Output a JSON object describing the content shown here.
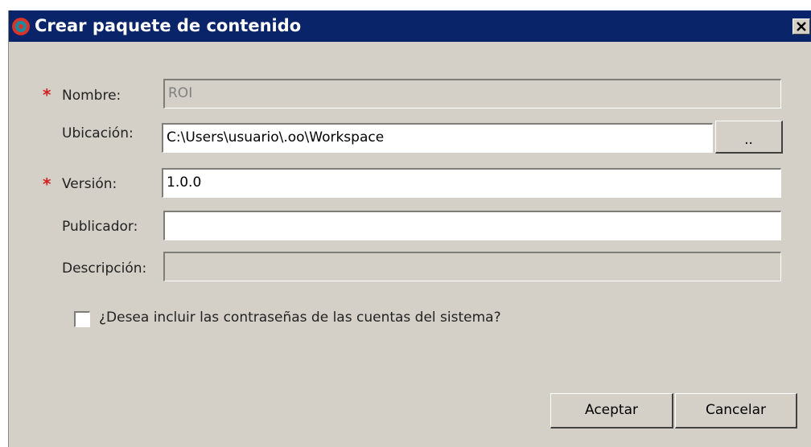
{
  "window": {
    "title": "Crear paquete de contenido",
    "icon": "app-logo-icon",
    "close_icon": "close-icon"
  },
  "form": {
    "nombre": {
      "label": "Nombre:",
      "value": "ROI",
      "required_mark": "*"
    },
    "ubicacion": {
      "label": "Ubicación:",
      "value": "C:\\Users\\usuario\\.oo\\Workspace",
      "browse_label": ".."
    },
    "version": {
      "label": "Versión:",
      "value": "1.0.0",
      "required_mark": "*"
    },
    "publicador": {
      "label": "Publicador:",
      "value": ""
    },
    "descripcion": {
      "label": "Descripción:",
      "value": ""
    },
    "include_passwords": {
      "label": "¿Desea incluir las contraseñas de las cuentas del sistema?",
      "checked": false
    }
  },
  "buttons": {
    "accept": "Aceptar",
    "cancel": "Cancelar"
  },
  "colors": {
    "titlebar": "#0a246a",
    "dialog_bg": "#d4d0c8",
    "required": "#d2201e"
  }
}
